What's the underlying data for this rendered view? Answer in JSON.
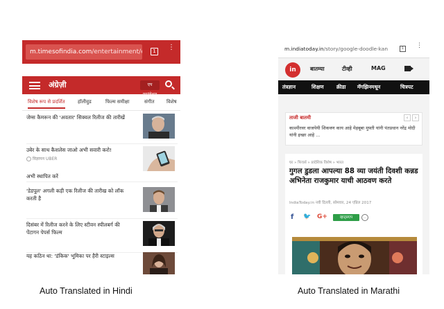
{
  "left_phone": {
    "url_host": "m.timesofindia.com",
    "url_path": "/entertainment/engli",
    "tab_count": "1",
    "brand": "अंग्रेज़ी",
    "edition_button": "एप फाउंडेशन",
    "nav": [
      "विशेष रूप से प्रदर्शित",
      "हॉलीवुड",
      "फिल्म समीक्षा",
      "संगीत",
      "विशेष"
    ],
    "items": [
      {
        "text": "जेम्स कैमरून की 'अवतार' सिक्वल रिलीज की तारीखें"
      },
      {
        "text": "उबेर के साथ कैशलेस जाओ अभी सवारी करो!"
      },
      {
        "text": "अभी स्थापित करें"
      },
      {
        "text": "'डेडपूल' अगली कड़ी एक रिलीज की तारीख को लॉक करती है"
      },
      {
        "text": "दिसंबर में रिलीज करने के लिए स्टीवन स्पीलबर्ग की पेंटागन पेपर्स फिल्म"
      },
      {
        "text": "यह कठिन था: 'डंकिक' भूमिका पर हैरी स्टाइल्स"
      }
    ],
    "sponsor": "विज्ञापन UBER"
  },
  "right_phone": {
    "url_host": "m.indiatoday.in",
    "url_path": "/story/google-doodle-kan",
    "tab_count": "1",
    "logo": "in",
    "top_nav": [
      "बातम्या",
      "टीव्ही",
      "MAG"
    ],
    "categories": [
      "तंत्रज्ञान",
      "शिक्षण",
      "क्रीडा",
      "मॅगझिनमधून",
      "चित्रपट"
    ],
    "breaking_label": "ताजी बातमी",
    "breaking_text": "काश्मीरवर वाजपेयी शिकवण काय आहे मेहबूबा मुफ्ती यांनी पंतप्रधान नरेंद्र मोदी यांनी इच्छा आहे ...",
    "breadcrumb": "घर » फिचर्स » प्रादेशिक विशेष » भारत",
    "headline": "गुगल डुडला आपल्या 88 व्या जयंती दिवशी कन्नड अभिनेता राजकुमार याची आठवण करते",
    "byline": "IndiaToday.in   नवी दिल्ली, सोमवार, 24 एप्रिल 2017",
    "share": [
      "f",
      "🐦",
      "G+"
    ],
    "whatsapp": "व्हाट्सएप"
  },
  "captions": {
    "left": "Auto Translated in Hindi",
    "right": "Auto Translated in Marathi"
  },
  "colors": {
    "toi_red": "#c42a2a",
    "indiatoday_red": "#d32f2f",
    "whatsapp_green": "#2e9e48"
  }
}
